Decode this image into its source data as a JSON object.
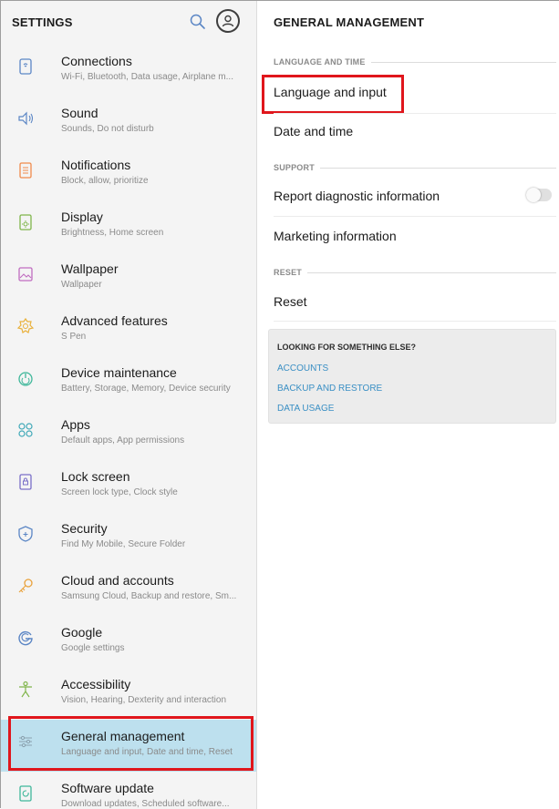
{
  "left_panel": {
    "title": "SETTINGS",
    "items": [
      {
        "title": "Connections",
        "subtitle": "Wi-Fi, Bluetooth, Data usage, Airplane m...",
        "icon": "connections-icon"
      },
      {
        "title": "Sound",
        "subtitle": "Sounds, Do not disturb",
        "icon": "sound-icon"
      },
      {
        "title": "Notifications",
        "subtitle": "Block, allow, prioritize",
        "icon": "notifications-icon"
      },
      {
        "title": "Display",
        "subtitle": "Brightness, Home screen",
        "icon": "display-icon"
      },
      {
        "title": "Wallpaper",
        "subtitle": "Wallpaper",
        "icon": "wallpaper-icon"
      },
      {
        "title": "Advanced features",
        "subtitle": "S Pen",
        "icon": "advanced-features-icon"
      },
      {
        "title": "Device maintenance",
        "subtitle": "Battery, Storage, Memory, Device security",
        "icon": "device-maintenance-icon"
      },
      {
        "title": "Apps",
        "subtitle": "Default apps, App permissions",
        "icon": "apps-icon"
      },
      {
        "title": "Lock screen",
        "subtitle": "Screen lock type, Clock style",
        "icon": "lock-screen-icon"
      },
      {
        "title": "Security",
        "subtitle": "Find My Mobile, Secure Folder",
        "icon": "security-icon"
      },
      {
        "title": "Cloud and accounts",
        "subtitle": "Samsung Cloud, Backup and restore, Sm...",
        "icon": "cloud-accounts-icon"
      },
      {
        "title": "Google",
        "subtitle": "Google settings",
        "icon": "google-icon"
      },
      {
        "title": "Accessibility",
        "subtitle": "Vision, Hearing, Dexterity and interaction",
        "icon": "accessibility-icon"
      },
      {
        "title": "General management",
        "subtitle": "Language and input, Date and time, Reset",
        "icon": "general-management-icon",
        "selected": true
      },
      {
        "title": "Software update",
        "subtitle": "Download updates, Scheduled software...",
        "icon": "software-update-icon"
      }
    ]
  },
  "right_panel": {
    "title": "GENERAL MANAGEMENT",
    "sections": {
      "language_time": "LANGUAGE AND TIME",
      "support": "SUPPORT",
      "reset": "RESET"
    },
    "items": {
      "language_input": "Language and input",
      "date_time": "Date and time",
      "report_diagnostic": "Report diagnostic information",
      "marketing_info": "Marketing information",
      "reset": "Reset"
    },
    "report_diagnostic_enabled": false,
    "looking_box": {
      "title": "LOOKING FOR SOMETHING ELSE?",
      "links": [
        "ACCOUNTS",
        "BACKUP AND RESTORE",
        "DATA USAGE"
      ]
    }
  },
  "colors": {
    "accent_link": "#3a8fc4",
    "selected_bg": "#bde0ee",
    "highlight_border": "#e0161c",
    "search_icon": "#5b86c5"
  }
}
